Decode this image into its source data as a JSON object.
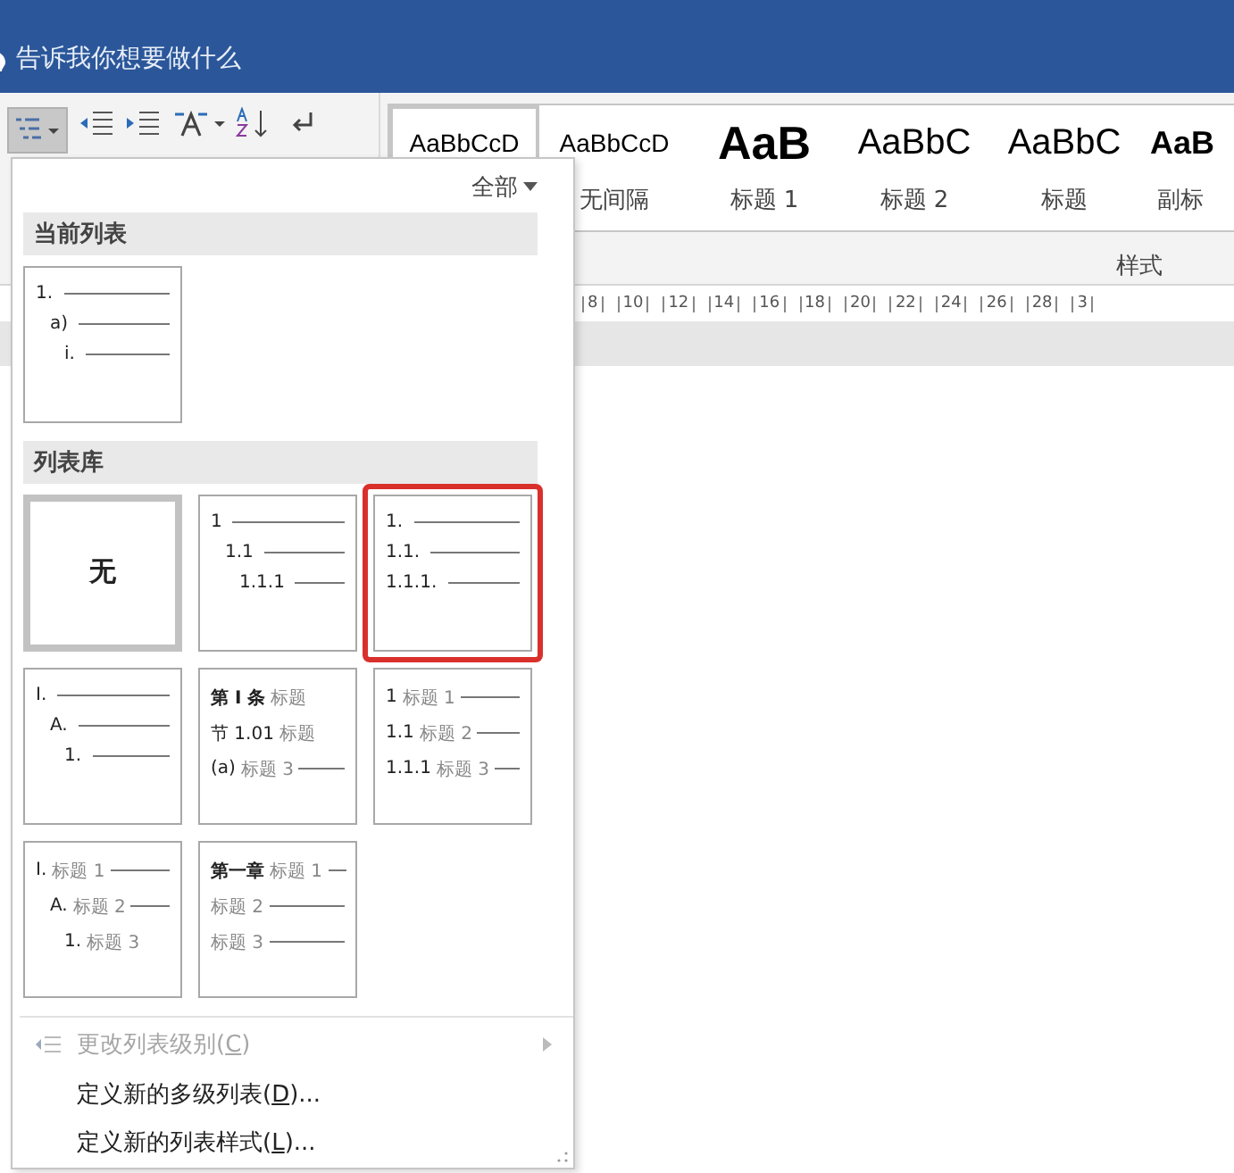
{
  "search": {
    "placeholder": "告诉我你想要做什么"
  },
  "multilevel_button": {
    "pressed": true
  },
  "styles": {
    "items": [
      {
        "kind": "normal",
        "sample": "AaBbCcD",
        "selected": true
      },
      {
        "kind": "normal",
        "sample": "AaBbCcD",
        "label": "无间隔",
        "selected": false
      },
      {
        "kind": "heading1",
        "sample": "AaB",
        "label": "标题 1",
        "selected": false
      },
      {
        "kind": "heading2",
        "sample": "AaBbC",
        "label": "标题 2",
        "selected": false
      },
      {
        "kind": "title",
        "sample": "AaBbC",
        "label": "标题",
        "selected": false
      },
      {
        "kind": "subtitle",
        "sample": "AaB",
        "label": "副标",
        "selected": false
      }
    ],
    "group_label": "样式"
  },
  "ruler": {
    "marks": [
      "8",
      "10",
      "12",
      "14",
      "16",
      "18",
      "20",
      "22",
      "24",
      "26",
      "28",
      "3"
    ]
  },
  "menu": {
    "filter": "全部",
    "sections": [
      {
        "title": "当前列表",
        "items": [
          {
            "kind": "list",
            "indented": true,
            "selected": false,
            "annotated": false,
            "lines": [
              {
                "number": "1.",
                "rule": true
              },
              {
                "number": "a)",
                "rule": true
              },
              {
                "number": "i.",
                "rule": true
              }
            ]
          }
        ]
      },
      {
        "title": "列表库",
        "items": [
          {
            "kind": "none",
            "label": "无",
            "selected": true,
            "annotated": false
          },
          {
            "kind": "list",
            "indented": true,
            "selected": false,
            "annotated": false,
            "lines": [
              {
                "number": "1",
                "rule": true
              },
              {
                "number": "1.1",
                "rule": true
              },
              {
                "number": "1.1.1",
                "rule": true
              }
            ]
          },
          {
            "kind": "list",
            "indented": false,
            "selected": false,
            "annotated": true,
            "lines": [
              {
                "number": "1.",
                "rule": true
              },
              {
                "number": "1.1.",
                "rule": true
              },
              {
                "number": "1.1.1.",
                "rule": true
              }
            ]
          },
          {
            "kind": "list",
            "indented": true,
            "selected": false,
            "annotated": false,
            "lines": [
              {
                "number": "I.",
                "rule": true
              },
              {
                "number": "A.",
                "rule": true
              },
              {
                "number": "1.",
                "rule": true
              }
            ]
          },
          {
            "kind": "list",
            "indented": false,
            "selected": false,
            "annotated": false,
            "lines": [
              {
                "number": "第 I 条",
                "heading": "标题",
                "rule": false
              },
              {
                "number": "节 1.01",
                "heading": "标题",
                "rule": false
              },
              {
                "number": "(a)",
                "heading": "标题 3",
                "rule": true
              }
            ]
          },
          {
            "kind": "list",
            "indented": false,
            "selected": false,
            "annotated": false,
            "lines": [
              {
                "number": "1",
                "heading": "标题 1",
                "rule": true
              },
              {
                "number": "1.1",
                "heading": "标题 2",
                "rule": true
              },
              {
                "number": "1.1.1",
                "heading": "标题 3",
                "rule": true
              }
            ]
          },
          {
            "kind": "list",
            "indented": true,
            "selected": false,
            "annotated": false,
            "lines": [
              {
                "number": "I.",
                "heading": "标题 1",
                "rule": true
              },
              {
                "number": "A.",
                "heading": "标题 2",
                "rule": true
              },
              {
                "number": "1.",
                "heading": "标题 3",
                "rule": false
              }
            ]
          },
          {
            "kind": "list",
            "indented": false,
            "selected": false,
            "annotated": false,
            "lines": [
              {
                "number": "第一章",
                "heading": "标题 1",
                "rule": true
              },
              {
                "heading": "标题 2",
                "rule": true
              },
              {
                "heading": "标题 3",
                "rule": true
              }
            ]
          }
        ]
      }
    ],
    "commands": [
      {
        "before": "更改列表级别(",
        "accel": "C",
        "after": ")",
        "disabled": true,
        "submenu": true,
        "icon": true
      },
      {
        "before": "定义新的多级列表(",
        "accel": "D",
        "after": ")...",
        "disabled": false,
        "submenu": false,
        "icon": false
      },
      {
        "before": "定义新的列表样式(",
        "accel": "L",
        "after": ")...",
        "disabled": false,
        "submenu": false,
        "icon": false
      }
    ]
  }
}
